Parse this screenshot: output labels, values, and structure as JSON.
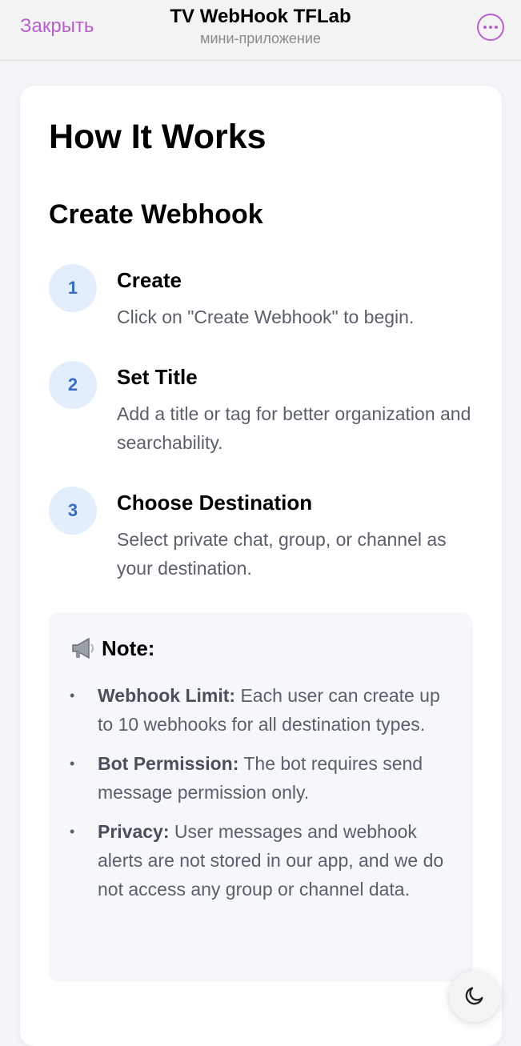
{
  "header": {
    "close_label": "Закрыть",
    "title": "TV WebHook TFLab",
    "subtitle": "мини-приложение",
    "menu_icon": "ellipsis-icon"
  },
  "content": {
    "heading": "How It Works",
    "subheading": "Create Webhook",
    "steps": [
      {
        "number": "1",
        "title": "Create",
        "description": "Click on \"Create Webhook\" to begin."
      },
      {
        "number": "2",
        "title": "Set Title",
        "description": "Add a title or tag for better organization and searchability."
      },
      {
        "number": "3",
        "title": "Choose Destination",
        "description": "Select private chat, group, or channel as your destination."
      }
    ],
    "note": {
      "icon": "megaphone-icon",
      "title": "Note:",
      "items": [
        {
          "label": "Webhook Limit:",
          "text": " Each user can create up to 10 webhooks for all destination types."
        },
        {
          "label": "Bot Permission:",
          "text": " The bot requires send message permission only."
        },
        {
          "label": "Privacy:",
          "text": " User messages and webhook alerts are not stored in our app, and we do not access any group or channel data."
        }
      ]
    }
  },
  "theme_toggle": {
    "icon": "moon-icon"
  },
  "colors": {
    "accent": "#b85fcc",
    "step_badge_bg": "#e3eefc",
    "step_badge_text": "#3a6cc0",
    "body_text": "#5a5f69"
  }
}
